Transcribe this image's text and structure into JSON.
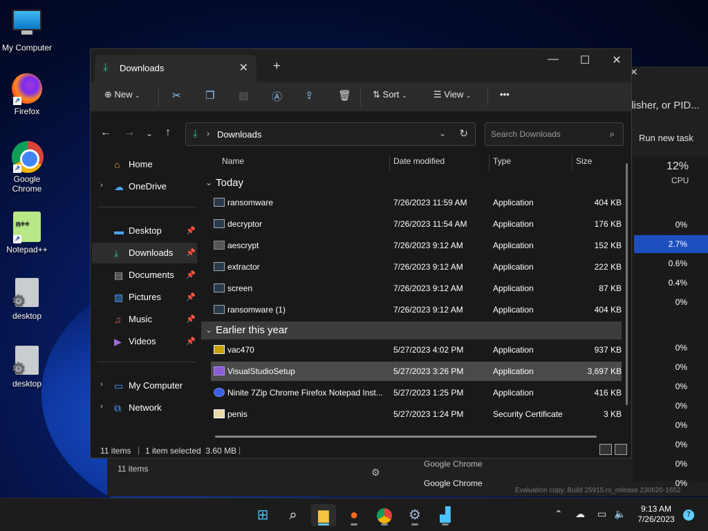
{
  "desktop": {
    "icons": [
      {
        "label": "My Computer"
      },
      {
        "label": "Firefox"
      },
      {
        "label": "Google Chrome"
      },
      {
        "label": "Notepad++"
      },
      {
        "label": "desktop"
      },
      {
        "label": "desktop"
      }
    ]
  },
  "taskmgr": {
    "search_partial": "plisher, or PID...",
    "run_new_task": "Run new task",
    "cpu_pct": "12%",
    "cpu_label": "CPU",
    "cpu_values": [
      "0%",
      "2.7%",
      "0.6%",
      "0.4%",
      "0%",
      "0%",
      "0%",
      "0%",
      "0%",
      "0%",
      "0%",
      "0%",
      "0%"
    ],
    "items_count": "11 items",
    "chrome_rows": [
      "Google Chrome",
      "Google Chrome"
    ],
    "watermark": "Evaluation copy. Build 25915.rs_release.230620-1652"
  },
  "explorer": {
    "tab_title": "Downloads",
    "toolbar": {
      "new_label": "New",
      "sort_label": "Sort",
      "view_label": "View",
      "more": "•••"
    },
    "address": "Downloads",
    "search_placeholder": "Search Downloads",
    "sidebar": {
      "home": "Home",
      "onedrive": "OneDrive",
      "desktop": "Desktop",
      "downloads": "Downloads",
      "documents": "Documents",
      "pictures": "Pictures",
      "music": "Music",
      "videos": "Videos",
      "mycomputer": "My Computer",
      "network": "Network"
    },
    "columns": {
      "name": "Name",
      "date": "Date modified",
      "type": "Type",
      "size": "Size"
    },
    "groups": {
      "today": "Today",
      "earlier": "Earlier this year"
    },
    "files_today": [
      {
        "name": "ransomware",
        "date": "7/26/2023 11:59 AM",
        "type": "Application",
        "size": "404 KB"
      },
      {
        "name": "decryptor",
        "date": "7/26/2023 11:54 AM",
        "type": "Application",
        "size": "176 KB"
      },
      {
        "name": "aescrypt",
        "date": "7/26/2023 9:12 AM",
        "type": "Application",
        "size": "152 KB"
      },
      {
        "name": "extractor",
        "date": "7/26/2023 9:12 AM",
        "type": "Application",
        "size": "222 KB"
      },
      {
        "name": "screen",
        "date": "7/26/2023 9:12 AM",
        "type": "Application",
        "size": "87 KB"
      },
      {
        "name": "ransomware (1)",
        "date": "7/26/2023 9:12 AM",
        "type": "Application",
        "size": "404 KB"
      }
    ],
    "files_earlier": [
      {
        "name": "vac470",
        "date": "5/27/2023 4:02 PM",
        "type": "Application",
        "size": "937 KB"
      },
      {
        "name": "VisualStudioSetup",
        "date": "5/27/2023 3:26 PM",
        "type": "Application",
        "size": "3,697 KB"
      },
      {
        "name": "Ninite 7Zip Chrome Firefox Notepad Inst...",
        "date": "5/27/2023 1:25 PM",
        "type": "Application",
        "size": "416 KB"
      },
      {
        "name": "penis",
        "date": "5/27/2023 1:24 PM",
        "type": "Security Certificate",
        "size": "3 KB"
      }
    ],
    "status": {
      "items": "11 items",
      "selected": "1 item selected  3.60 MB"
    }
  },
  "taskbar": {
    "time": "9:13 AM",
    "date": "7/26/2023",
    "notifications": "7"
  }
}
